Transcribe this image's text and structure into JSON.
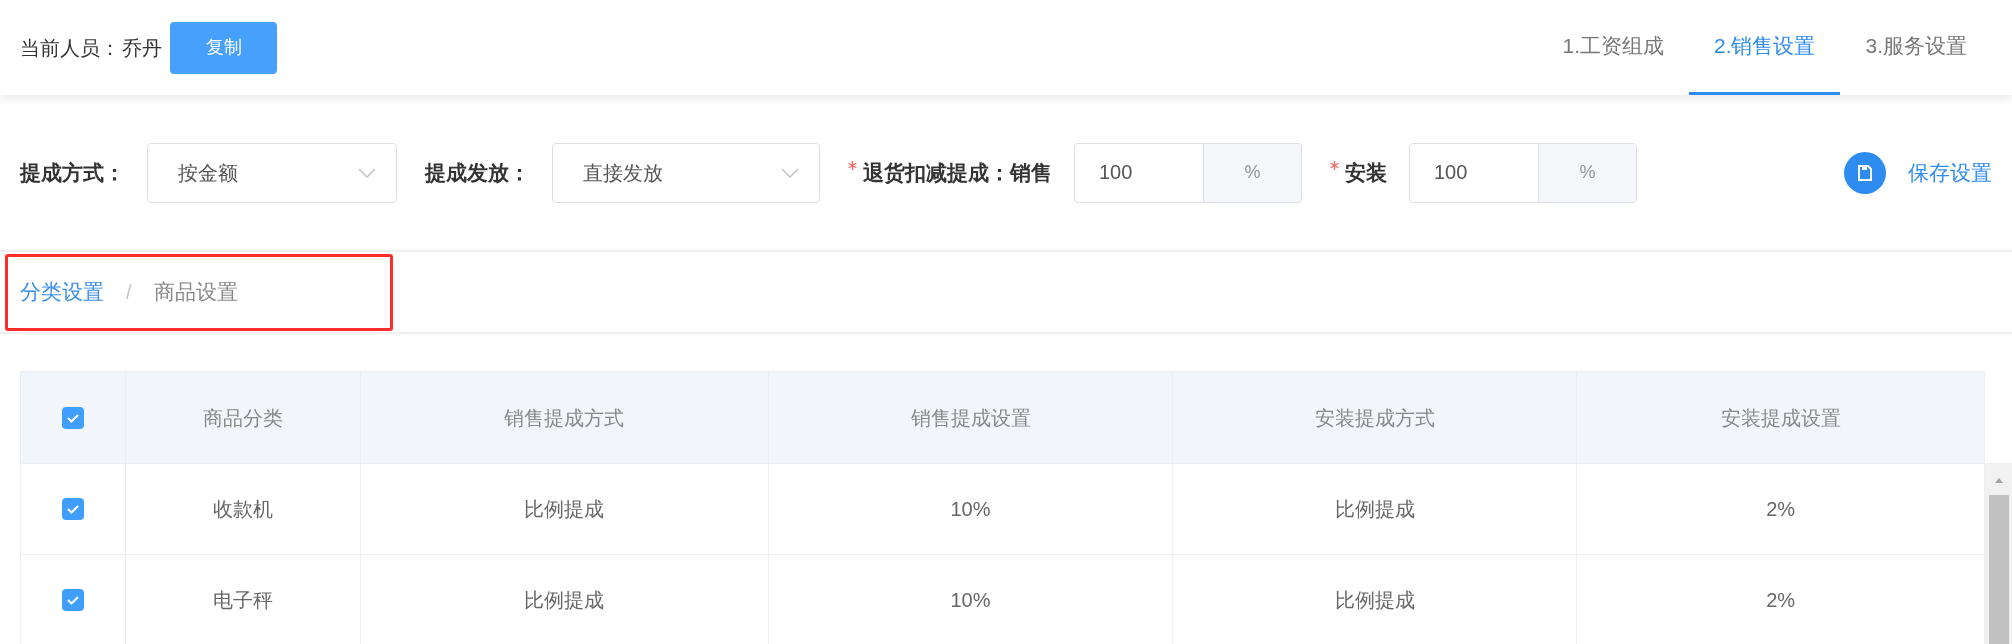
{
  "header": {
    "person_label": "当前人员：",
    "person_name": "乔丹",
    "copy_button": "复制"
  },
  "tabs": [
    {
      "label": "1.工资组成",
      "selected": false
    },
    {
      "label": "2.销售设置",
      "selected": true
    },
    {
      "label": "3.服务设置",
      "selected": false
    }
  ],
  "settings": [
    {
      "kind": "select",
      "label": "提成方式：",
      "required": false,
      "value": "按金额"
    },
    {
      "kind": "select",
      "label": "提成发放：",
      "required": false,
      "value": "直接发放"
    },
    {
      "kind": "input",
      "label": "退货扣减提成：销售",
      "required": true,
      "value": "100",
      "unit": "%"
    },
    {
      "kind": "input",
      "label": "安装",
      "required": true,
      "value": "100",
      "unit": "%"
    }
  ],
  "save_button": "保存设置",
  "breadcrumb": [
    {
      "label": "分类设置",
      "current": false
    },
    {
      "label": "商品设置",
      "current": true
    }
  ],
  "breadcrumb_separator": "/",
  "table": {
    "header_checked": true,
    "columns": [
      "商品分类",
      "销售提成方式",
      "销售提成设置",
      "安装提成方式",
      "安装提成设置"
    ],
    "rows": [
      {
        "checked": true,
        "cells": [
          "收款机",
          "比例提成",
          "10%",
          "比例提成",
          "2%"
        ]
      },
      {
        "checked": true,
        "cells": [
          "电子秤",
          "比例提成",
          "10%",
          "比例提成",
          "2%"
        ]
      }
    ]
  }
}
